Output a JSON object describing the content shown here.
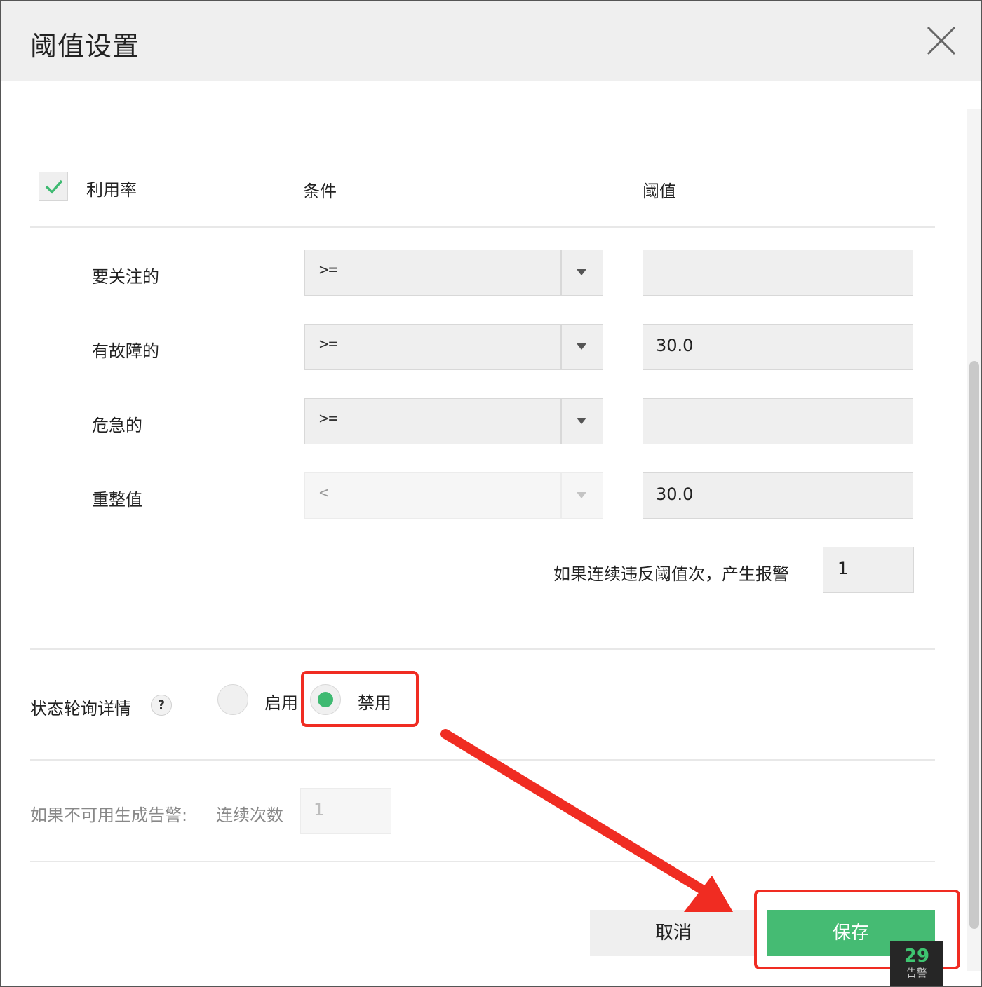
{
  "dialog": {
    "title": "阈值设置",
    "close_icon": "close-icon"
  },
  "table": {
    "enabled": true,
    "header_metric": "利用率",
    "header_condition": "条件",
    "header_threshold": "阈值",
    "rows": [
      {
        "label": "要关注的",
        "condition": ">=",
        "threshold": ""
      },
      {
        "label": "有故障的",
        "condition": ">=",
        "threshold": "30.0"
      },
      {
        "label": "危急的",
        "condition": ">=",
        "threshold": ""
      },
      {
        "label": "重整值",
        "condition": "<",
        "threshold": "30.0"
      }
    ],
    "consecutive_label": "如果连续违反阈值次，产生报警",
    "consecutive_value": "1"
  },
  "poll": {
    "label": "状态轮询详情",
    "help": "?",
    "enable_label": "启用",
    "disable_label": "禁用",
    "selected": "禁用"
  },
  "unavailable": {
    "label": "如果不可用生成告警:",
    "count_label": "连续次数",
    "count_value": "1"
  },
  "footer": {
    "cancel_label": "取消",
    "save_label": "保存"
  },
  "alarm_badge": {
    "count": "29",
    "label": "告警"
  },
  "colors": {
    "accent_green": "#45bb73",
    "annotation_red": "#f02c22"
  }
}
